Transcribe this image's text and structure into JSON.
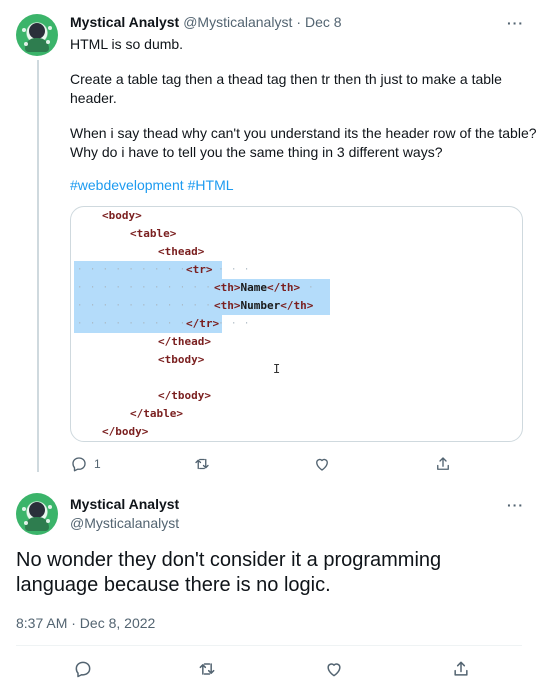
{
  "reply_tweet": {
    "author_name": "Mystical Analyst",
    "handle": "@Mysticalanalyst",
    "separator": "·",
    "date": "Dec 8",
    "text_line1": "HTML is so dumb.",
    "text_para2_line1": "Create a table tag then a thead tag then tr then th just to make a table",
    "text_para2_line2": "header.",
    "text_para3_line1": "When i say thead why can't you understand its the header row of the table?",
    "text_para3_line2": "Why do i have to tell you the same thing in 3 different ways?",
    "hashtags": [
      "#webdevelopment",
      "#HTML"
    ],
    "code_lines": [
      {
        "tag": "<body>"
      },
      {
        "tag": "<table>"
      },
      {
        "tag": "<thead>"
      },
      {
        "tag": "<tr>"
      },
      {
        "open": "<th>",
        "text": "Name",
        "close": "</th>"
      },
      {
        "open": "<th>",
        "text": "Number",
        "close": "</th>"
      },
      {
        "tag": "</tr>"
      },
      {
        "tag": "</thead>"
      },
      {
        "tag": "<tbody>"
      },
      {
        "tag": ""
      },
      {
        "tag": "</tbody>"
      },
      {
        "tag": "</table>"
      },
      {
        "tag": "</body>"
      }
    ],
    "reply_count": "1",
    "icons": [
      "reply-icon",
      "retweet-icon",
      "like-icon",
      "share-icon"
    ]
  },
  "main_tweet": {
    "author_name": "Mystical Analyst",
    "handle": "@Mysticalanalyst",
    "text_line1": "No wonder they don't consider it a programming",
    "text_line2": "language because there is no logic.",
    "timestamp": "8:37 AM · Dec 8, 2022",
    "icons": [
      "reply-icon",
      "retweet-icon",
      "like-icon",
      "share-icon"
    ]
  },
  "colors": {
    "text": "#0f1419",
    "muted": "#536471",
    "link": "#1d9bf0",
    "selection": "#b4dcfa",
    "code_tag": "#7a1f1f"
  }
}
